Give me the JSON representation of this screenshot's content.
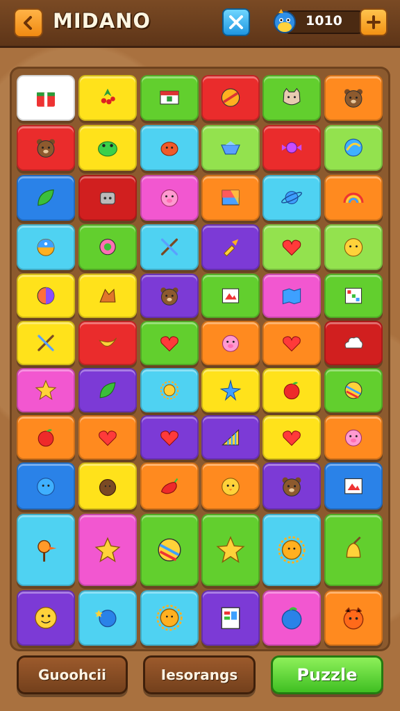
{
  "header": {
    "title": "MIDANO",
    "coins": "1010",
    "icons": {
      "back": "back-arrow-icon",
      "shuffle": "shuffle-icon",
      "coin": "coin-mascot-icon",
      "add": "plus-icon"
    }
  },
  "colors": {
    "red": "#ea2c2c",
    "yellow": "#ffe21b",
    "green": "#62cf2e",
    "cyan": "#4fd2f2",
    "lime": "#93e24e",
    "orange": "#ff8a1f",
    "blue": "#2a82e8",
    "pink": "#f257d0",
    "purple": "#7c3ad6",
    "white": "#ffffff",
    "darkred": "#d11f1f"
  },
  "tiles": [
    [
      {
        "bg": "white",
        "icon": "gift-box"
      },
      {
        "bg": "yellow",
        "icon": "berry-bush"
      },
      {
        "bg": "green",
        "icon": "flag"
      },
      {
        "bg": "red",
        "icon": "striped-ball"
      },
      {
        "bg": "green",
        "icon": "cat-face"
      },
      {
        "bg": "orange",
        "icon": "bear-face"
      }
    ],
    [
      {
        "bg": "red",
        "icon": "bear-face"
      },
      {
        "bg": "yellow",
        "icon": "frog-face"
      },
      {
        "bg": "cyan",
        "icon": "crab"
      },
      {
        "bg": "lime",
        "icon": "gem-bowl"
      },
      {
        "bg": "red",
        "icon": "candy"
      },
      {
        "bg": "lime",
        "icon": "marble"
      }
    ],
    [
      {
        "bg": "blue",
        "icon": "leaf"
      },
      {
        "bg": "darkred",
        "icon": "robot-face"
      },
      {
        "bg": "pink",
        "icon": "pig-face"
      },
      {
        "bg": "orange",
        "icon": "color-block"
      },
      {
        "bg": "cyan",
        "icon": "planet"
      },
      {
        "bg": "orange",
        "icon": "rainbow"
      }
    ],
    [
      {
        "bg": "cyan",
        "icon": "sun-ball"
      },
      {
        "bg": "green",
        "icon": "flower"
      },
      {
        "bg": "cyan",
        "icon": "tools"
      },
      {
        "bg": "purple",
        "icon": "flashlight"
      },
      {
        "bg": "lime",
        "icon": "heart"
      },
      {
        "bg": "lime",
        "icon": "lion-face"
      }
    ],
    [
      {
        "bg": "yellow",
        "icon": "color-ball"
      },
      {
        "bg": "yellow",
        "icon": "squirrel"
      },
      {
        "bg": "purple",
        "icon": "bear-face"
      },
      {
        "bg": "green",
        "icon": "picture"
      },
      {
        "bg": "pink",
        "icon": "map"
      },
      {
        "bg": "green",
        "icon": "board-game"
      }
    ],
    [
      {
        "bg": "yellow",
        "icon": "tools"
      },
      {
        "bg": "red",
        "icon": "banana"
      },
      {
        "bg": "green",
        "icon": "heart"
      },
      {
        "bg": "orange",
        "icon": "pig-face"
      },
      {
        "bg": "orange",
        "icon": "heart"
      },
      {
        "bg": "darkred",
        "icon": "cloud-face"
      }
    ],
    [
      {
        "bg": "pink",
        "icon": "star"
      },
      {
        "bg": "purple",
        "icon": "leaf"
      },
      {
        "bg": "cyan",
        "icon": "sun"
      },
      {
        "bg": "yellow",
        "icon": "starfish"
      },
      {
        "bg": "yellow",
        "icon": "apple"
      },
      {
        "bg": "green",
        "icon": "rainbow-ball"
      }
    ],
    [
      {
        "bg": "orange",
        "icon": "apple"
      },
      {
        "bg": "orange",
        "icon": "heart"
      },
      {
        "bg": "purple",
        "icon": "heart"
      },
      {
        "bg": "purple",
        "icon": "chart"
      },
      {
        "bg": "yellow",
        "icon": "heart"
      },
      {
        "bg": "orange",
        "icon": "pig-face"
      }
    ],
    [
      {
        "bg": "blue",
        "icon": "blob-face"
      },
      {
        "bg": "yellow",
        "icon": "coconut"
      },
      {
        "bg": "orange",
        "icon": "pepper"
      },
      {
        "bg": "orange",
        "icon": "chick-face"
      },
      {
        "bg": "purple",
        "icon": "bear-face"
      },
      {
        "bg": "blue",
        "icon": "picture"
      }
    ],
    [
      {
        "bg": "cyan",
        "icon": "duck"
      },
      {
        "bg": "pink",
        "icon": "star-bag"
      },
      {
        "bg": "green",
        "icon": "rainbow-ball"
      },
      {
        "bg": "green",
        "icon": "star"
      },
      {
        "bg": "cyan",
        "icon": "sun-face"
      },
      {
        "bg": "green",
        "icon": "bell"
      }
    ],
    [
      {
        "bg": "purple",
        "icon": "smiley"
      },
      {
        "bg": "cyan",
        "icon": "star-ball"
      },
      {
        "bg": "cyan",
        "icon": "sun-face"
      },
      {
        "bg": "purple",
        "icon": "notebook"
      },
      {
        "bg": "pink",
        "icon": "blueberry"
      },
      {
        "bg": "orange",
        "icon": "monster-face"
      }
    ]
  ],
  "buttons": {
    "left": "Guoohcii",
    "middle": "Iesorangs",
    "right": "Puzzle"
  }
}
